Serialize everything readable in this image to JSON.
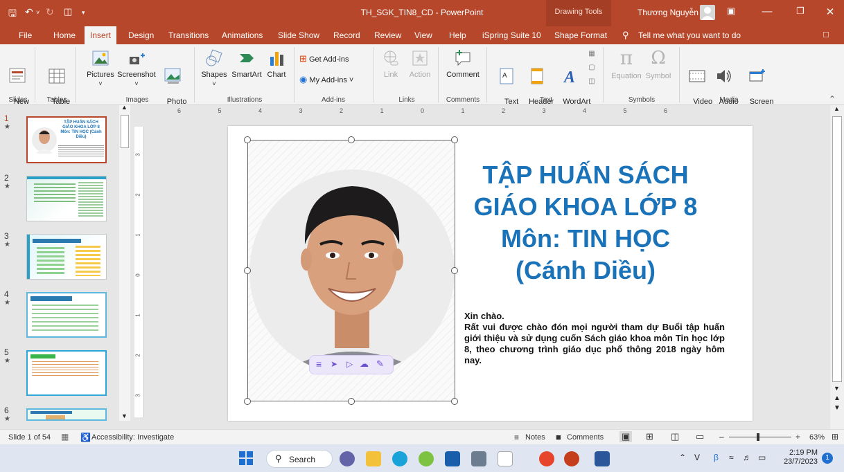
{
  "titlebar": {
    "document_title": "TH_SGK_TIN8_CD  -  PowerPoint",
    "context_tab_group": "Drawing Tools",
    "user_name": "Thương Nguyễn"
  },
  "tabs": [
    "File",
    "Home",
    "Insert",
    "Design",
    "Transitions",
    "Animations",
    "Slide Show",
    "Record",
    "Review",
    "View",
    "Help",
    "iSpring Suite 10",
    "Shape Format"
  ],
  "active_tab": "Insert",
  "tell_me": "Tell me what you want to do",
  "ribbon": {
    "new_slide": "New\nSlide ˅",
    "table": "Table\n˅",
    "pictures": "Pictures",
    "screenshot": "Screenshot",
    "photo_album": "Photo\nAlbum ˅",
    "shapes": "Shapes",
    "smartart": "SmartArt",
    "chart": "Chart",
    "get_addins": "Get Add-ins",
    "my_addins": "My Add-ins ˅",
    "link": "Link",
    "action": "Action",
    "comment": "Comment",
    "text_box": "Text\nBox",
    "header_footer": "Header\n& Footer",
    "wordart": "WordArt\n˅",
    "equation": "Equation",
    "symbol": "Symbol",
    "video": "Video\n˅",
    "audio": "Audio\n˅",
    "screen_recording": "Screen\nRecording",
    "groups": {
      "slides": "Slides",
      "tables": "Tables",
      "images": "Images",
      "illustrations": "Illustrations",
      "addins": "Add-ins",
      "links": "Links",
      "comments": "Comments",
      "text": "Text",
      "symbols": "Symbols",
      "media": "Media"
    }
  },
  "ruler_labels": [
    "6",
    "5",
    "4",
    "3",
    "2",
    "1",
    "0",
    "1",
    "2",
    "3",
    "4",
    "5",
    "6"
  ],
  "vruler_labels": [
    "3",
    "2",
    "1",
    "0",
    "1",
    "2",
    "3"
  ],
  "thumbnails": [
    {
      "num": "1",
      "title": "TẬP HUẤN SÁCH GIÁO KHOA LỚP 8 Môn: TIN HỌC (Cánh Diều)"
    },
    {
      "num": "2"
    },
    {
      "num": "3"
    },
    {
      "num": "4"
    },
    {
      "num": "5"
    },
    {
      "num": "6"
    }
  ],
  "slide": {
    "title_lines": [
      "TẬP HUẤN SÁCH",
      "GIÁO KHOA LỚP 8",
      "Môn: TIN HỌC",
      "(Cánh Diều)"
    ],
    "greeting": "Xin chào.",
    "body": "Rất vui được chào đón mọi người tham dự Buổi tập huấn giới thiệu và sử dụng cuốn Sách giáo khoa môn Tin học lớp 8, theo chương trình giáo dục phổ thông 2018 ngày hôm nay."
  },
  "statusbar": {
    "slide_info": "Slide 1 of 54",
    "accessibility": "Accessibility: Investigate",
    "notes": "Notes",
    "comments": "Comments",
    "zoom": "63%"
  },
  "taskbar": {
    "search": "Search",
    "time": "2:19 PM",
    "date": "23/7/2023",
    "notification_count": "1"
  },
  "colors": {
    "accent": "#b7472a",
    "title_blue": "#1a73b8"
  }
}
